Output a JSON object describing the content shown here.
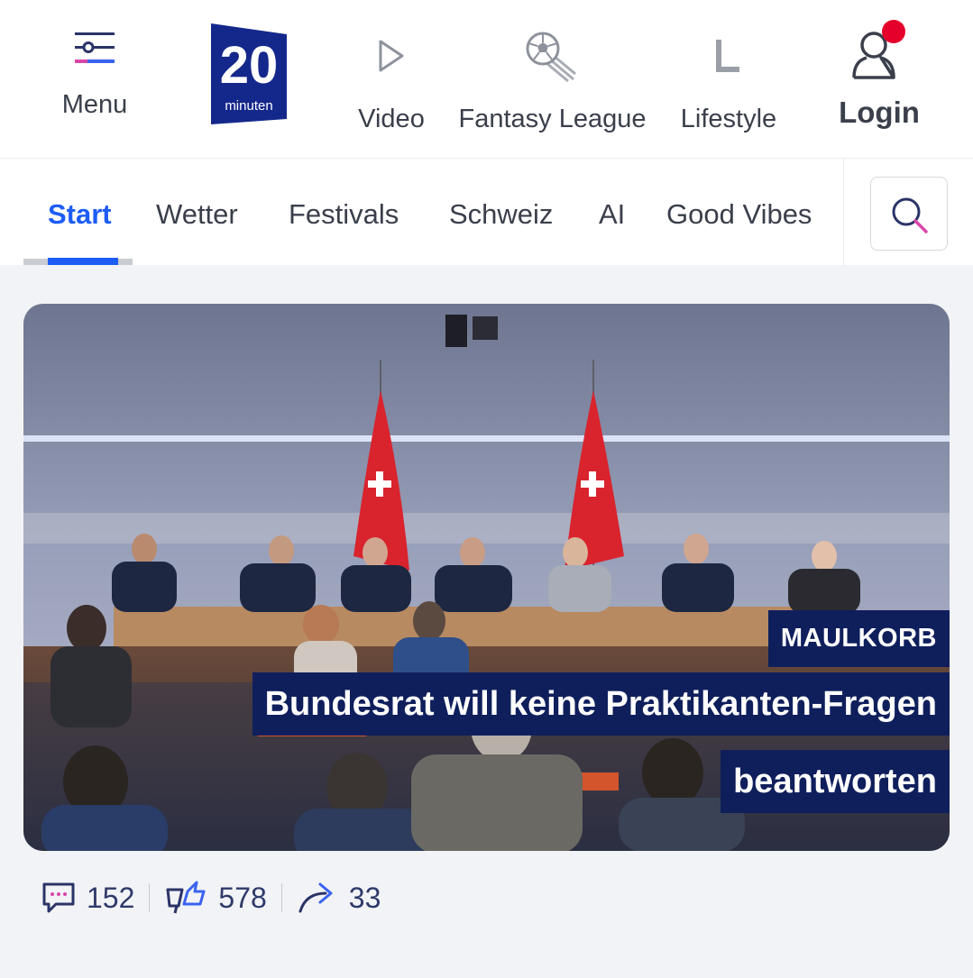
{
  "header": {
    "menu_label": "Menu",
    "logo_alt": "20 minuten",
    "nav": [
      {
        "label": "Video",
        "icon": "play-icon"
      },
      {
        "label": "Fantasy League",
        "icon": "football-icon"
      },
      {
        "label": "Lifestyle",
        "icon": "lifestyle-icon"
      }
    ],
    "login_label": "Login",
    "notification_dot_color": "#e4002b"
  },
  "tabs": {
    "items": [
      "Start",
      "Wetter",
      "Festivals",
      "Schweiz",
      "AI",
      "Good Vibes"
    ],
    "active": "Start",
    "accent_color": "#1d5cf5"
  },
  "teaser": {
    "kicker": "MAULKORB",
    "headline_line1": "Bundesrat will keine Praktikanten-Fragen",
    "headline_line2": "beantworten",
    "comments": "152",
    "reactions": "578",
    "shares": "33"
  }
}
